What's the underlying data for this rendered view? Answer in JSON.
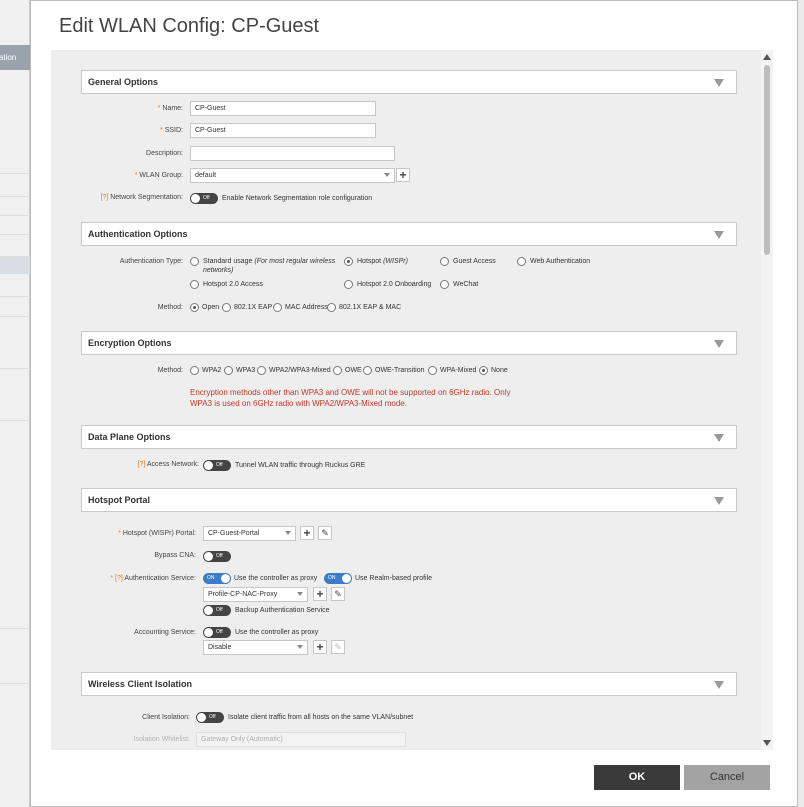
{
  "background": {
    "tab_label": "tration"
  },
  "dialog": {
    "title": "Edit WLAN Config: CP-Guest"
  },
  "general": {
    "title": "General Options",
    "name_label": "Name:",
    "name_value": "CP-Guest",
    "ssid_label": "SSID:",
    "ssid_value": "CP-Guest",
    "description_label": "Description:",
    "description_value": "",
    "wlan_group_label": "WLAN Group:",
    "wlan_group_value": "default",
    "segmentation_label": "Network Segmentation:",
    "segmentation_toggle": "Off",
    "segmentation_text": "Enable Network Segmentation role configuration"
  },
  "auth": {
    "title": "Authentication Options",
    "type_label": "Authentication Type:",
    "standard_usage": "Standard usage",
    "standard_usage_note": "(For most regular wireless",
    "standard_usage_note2": "networks)",
    "hotspot_wispr": "Hotspot",
    "hotspot_wispr_note": "(WISPr)",
    "guest_access": "Guest Access",
    "web_auth": "Web Authentication",
    "hotspot20_access": "Hotspot 2.0 Access",
    "hotspot20_onboarding": "Hotspot 2.0 Onboarding",
    "wechat": "WeChat",
    "method_label": "Method:",
    "methods": [
      "Open",
      "802.1X EAP",
      "MAC Address",
      "802.1X EAP & MAC"
    ]
  },
  "encryption": {
    "title": "Encryption Options",
    "method_label": "Method:",
    "methods": [
      "WPA2",
      "WPA3",
      "WPA2/WPA3-Mixed",
      "OWE",
      "OWE-Transition",
      "WPA-Mixed",
      "None"
    ],
    "warning_line1": "Encryption methods other than WPA3 and OWE will not be supported on 6GHz radio. Only",
    "warning_line2": "WPA3 is used on 6GHz radio with WPA2/WPA3-Mixed mode."
  },
  "dataplane": {
    "title": "Data Plane Options",
    "access_network_label": "Access Network:",
    "toggle": "Off",
    "text": "Tunnel WLAN traffic through Ruckus GRE"
  },
  "hotspot": {
    "title": "Hotspot Portal",
    "portal_label": "Hotspot (WISPr) Portal:",
    "portal_value": "CP-Guest-Portal",
    "bypass_label": "Bypass CNA:",
    "bypass_toggle": "Off",
    "auth_service_label": "Authentication Service:",
    "proxy_toggle": "ON",
    "proxy_text": "Use the controller as proxy",
    "realm_toggle": "ON",
    "realm_text": "Use Realm-based profile",
    "auth_profile_value": "Profile-CP-NAC-Proxy",
    "backup_toggle": "Off",
    "backup_text": "Backup Authentication Service",
    "accounting_label": "Accounting Service:",
    "acct_toggle": "Off",
    "acct_text": "Use the controller as proxy",
    "acct_value": "Disable"
  },
  "isolation": {
    "title": "Wireless Client Isolation",
    "client_label": "Client Isolation:",
    "toggle": "Off",
    "text": "Isolate client traffic from all hosts on the same VLAN/subnet",
    "whitelist_label": "Isolation Whitelist:",
    "whitelist_value": "Gateway Only (Automatic)"
  },
  "footer": {
    "ok_label": "OK",
    "cancel_label": "Cancel"
  }
}
